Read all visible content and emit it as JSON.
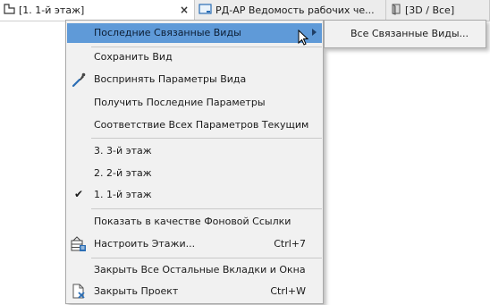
{
  "tabs": [
    {
      "label": "[1. 1-й этаж]",
      "close": "×",
      "icon": "floor-plan-icon",
      "active": true
    },
    {
      "label": "РД-АР Ведомость рабочих че...",
      "icon": "layout-sheet-icon",
      "active": false
    },
    {
      "label": "[3D / Все]",
      "icon": "3d-window-icon",
      "active": false
    }
  ],
  "menu": {
    "recent_linked": "Последние Связанные Виды",
    "save_view": "Сохранить Вид",
    "pick_params": "Воспринять Параметры Вида",
    "get_last_params": "Получить Последние Параметры",
    "match_all": "Соответствие Всех Параметров Текущим",
    "floors": [
      {
        "label": "3. 3-й этаж",
        "checked": false
      },
      {
        "label": "2. 2-й этаж",
        "checked": false
      },
      {
        "label": "1. 1-й этаж",
        "checked": true
      }
    ],
    "show_as_trace": "Показать в качестве Фоновой Ссылки",
    "floor_settings": "Настроить Этажи...",
    "floor_settings_shortcut": "Ctrl+7",
    "close_others": "Закрыть Все Остальные Вкладки и Окна",
    "close_project": "Закрыть Проект",
    "close_project_shortcut": "Ctrl+W",
    "check_glyph": "✔"
  },
  "submenu": {
    "all_linked": "Все Связанные Виды..."
  },
  "colors": {
    "highlight": "#5f9ad8",
    "menu_bg": "#f1f1f1",
    "tabbar_bg": "#f2f2f2"
  }
}
